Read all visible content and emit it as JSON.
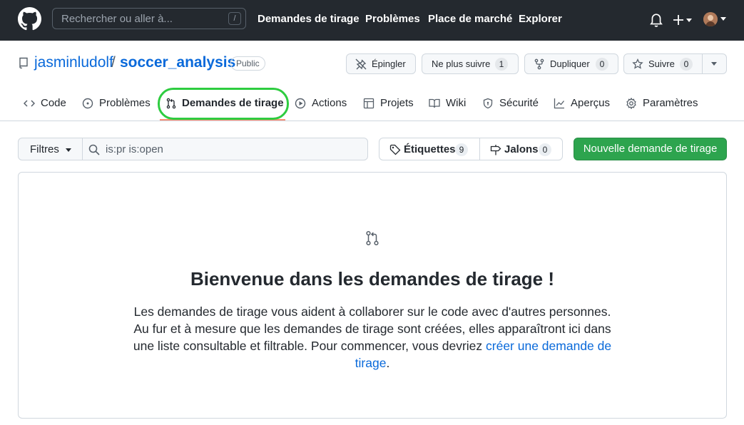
{
  "header": {
    "search_placeholder": "Rechercher ou aller à...",
    "search_shortcut": "/",
    "nav": [
      "Demandes de tirage",
      "Problèmes",
      "Place de marché",
      "Explorer"
    ],
    "icons": [
      "github-logo-icon",
      "bell-icon",
      "plus-icon",
      "avatar"
    ]
  },
  "repo": {
    "owner": "jasminludolf",
    "separator": "/",
    "name": "soccer_analysis",
    "visibility": "Public",
    "pin_label": "Épingler",
    "unwatch_label": "Ne plus suivre",
    "unwatch_count": "1",
    "fork_label": "Dupliquer",
    "fork_count": "0",
    "star_label": "Suivre",
    "star_count": "0"
  },
  "tabs": [
    {
      "label": "Code",
      "icon": "code-icon"
    },
    {
      "label": "Problèmes",
      "icon": "issue-icon"
    },
    {
      "label": "Demandes de tirage",
      "icon": "pull-request-icon",
      "active": true
    },
    {
      "label": "Actions",
      "icon": "play-icon"
    },
    {
      "label": "Projets",
      "icon": "table-icon"
    },
    {
      "label": "Wiki",
      "icon": "book-icon"
    },
    {
      "label": "Sécurité",
      "icon": "shield-icon"
    },
    {
      "label": "Aperçus",
      "icon": "graph-icon"
    },
    {
      "label": "Paramètres",
      "icon": "gear-icon"
    }
  ],
  "toolbar": {
    "filters_label": "Filtres",
    "filter_value": "is:pr is:open",
    "labels_label": "Étiquettes",
    "labels_count": "9",
    "milestones_label": "Jalons",
    "milestones_count": "0",
    "new_pr_label": "Nouvelle demande de tirage"
  },
  "blankslate": {
    "title": "Bienvenue dans les demandes de tirage !",
    "body_before": "Les demandes de tirage vous aident à collaborer sur le code avec d'autres personnes. Au fur et à mesure que les demandes de tirage sont créées, elles apparaîtront ici dans une liste consultable et filtrable. Pour commencer, vous devriez ",
    "link_text": "créer une demande de tirage",
    "body_after": "."
  },
  "colors": {
    "header_bg": "#24292f",
    "link": "#0969da",
    "primary_button": "#2da44e",
    "active_tab_underline": "#fd8c73",
    "highlight_ring": "#2ecc40"
  }
}
